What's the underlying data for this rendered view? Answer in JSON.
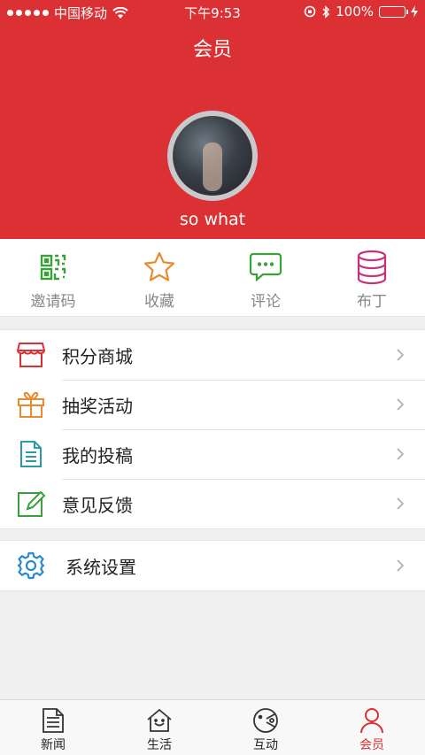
{
  "status_bar": {
    "carrier": "中国移动",
    "time": "下午9:53",
    "battery": "100%"
  },
  "header": {
    "title": "会员",
    "username": "so what",
    "background_color": "#dc3134"
  },
  "quick_actions": [
    {
      "label": "邀请码",
      "icon": "qr-code-icon",
      "color": "#3aa03a"
    },
    {
      "label": "收藏",
      "icon": "star-icon",
      "color": "#e98a2e"
    },
    {
      "label": "评论",
      "icon": "comment-icon",
      "color": "#3aa03a"
    },
    {
      "label": "布丁",
      "icon": "database-icon",
      "color": "#c8327a"
    }
  ],
  "menu_group_1": [
    {
      "label": "积分商城",
      "icon": "store-icon",
      "color": "#dc3134"
    },
    {
      "label": "抽奖活动",
      "icon": "gift-icon",
      "color": "#e98a2e"
    },
    {
      "label": "我的投稿",
      "icon": "document-icon",
      "color": "#2a9aa6"
    },
    {
      "label": "意见反馈",
      "icon": "edit-icon",
      "color": "#3aa03a"
    }
  ],
  "menu_group_2": [
    {
      "label": "系统设置",
      "icon": "gear-icon",
      "color": "#2a8ad0"
    }
  ],
  "tab_bar": [
    {
      "label": "新闻",
      "icon": "news-icon"
    },
    {
      "label": "生活",
      "icon": "home-icon"
    },
    {
      "label": "互动",
      "icon": "interact-icon"
    },
    {
      "label": "会员",
      "icon": "user-icon",
      "active": true
    }
  ],
  "accent_color": "#dc3134"
}
